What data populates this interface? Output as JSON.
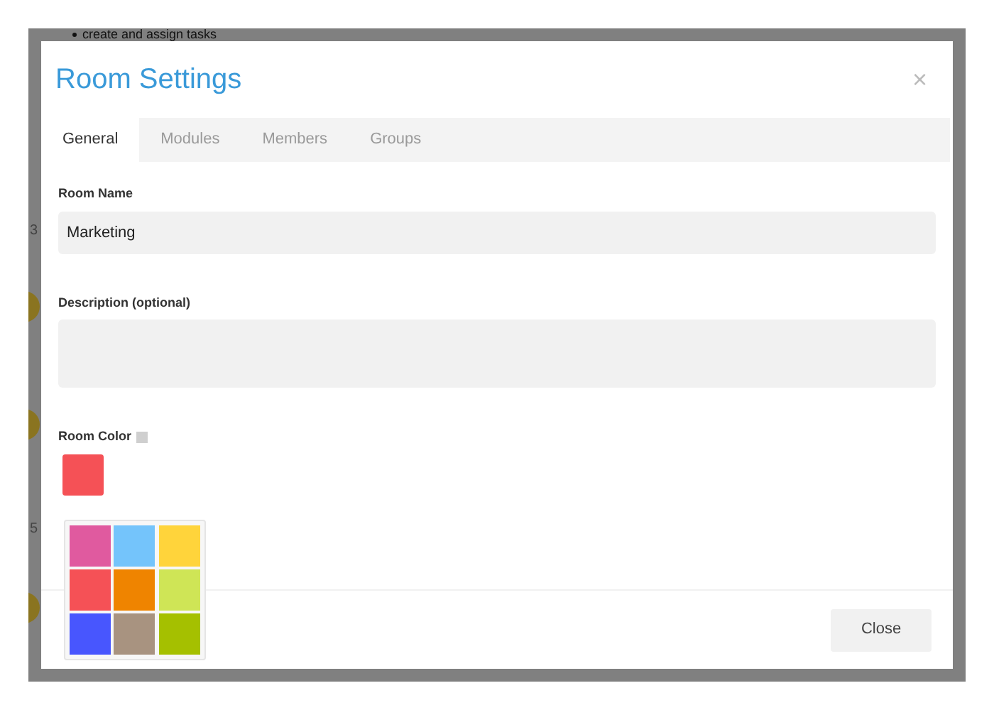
{
  "background": {
    "bullet": "create and assign tasks",
    "numbers": [
      "3",
      "5"
    ]
  },
  "dialog": {
    "title": "Room Settings",
    "close_icon": "×",
    "tabs": [
      {
        "label": "General",
        "selected": true
      },
      {
        "label": "Modules",
        "selected": false
      },
      {
        "label": "Members",
        "selected": false
      },
      {
        "label": "Groups",
        "selected": false
      }
    ],
    "room_name": {
      "label": "Room Name",
      "value": "Marketing"
    },
    "description": {
      "label": "Description (optional)"
    },
    "room_color": {
      "label": "Room Color",
      "color": "#f55156",
      "palette": [
        {
          "color": "#e05a9f"
        },
        {
          "color": "#74c4fb"
        },
        {
          "color": "#ffd43b"
        },
        {
          "color": "#f55156"
        },
        {
          "color": "#ef8400"
        },
        {
          "color": "#cfe556"
        },
        {
          "color": "#4856fe"
        },
        {
          "color": "#a89380"
        },
        {
          "color": "#a5c000"
        }
      ]
    },
    "buttons": [
      "Close"
    ]
  }
}
